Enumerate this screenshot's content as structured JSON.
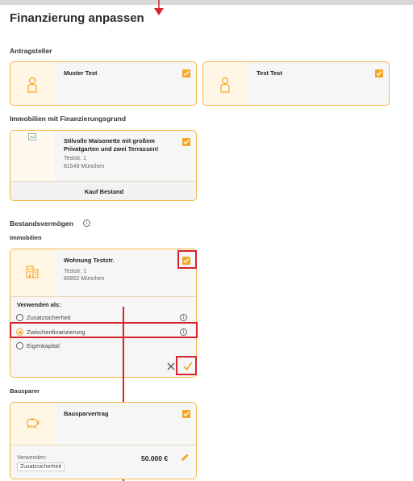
{
  "title": "Finanzierung anpassen",
  "applicants": {
    "heading": "Antragsteller",
    "items": [
      {
        "name": "Muster Test",
        "icon": "person-icon",
        "checked": true
      },
      {
        "name": "Test Test",
        "icon": "person-icon",
        "checked": true
      }
    ]
  },
  "property_reason": {
    "heading": "Immobilien mit Finanzierungsgrund",
    "item": {
      "title": "Stilvolle Maisonette mit großem Privatgarten und zwei Terrassen!",
      "street": "Teststr. 1",
      "city": "81549 München",
      "footer": "Kauf Bestand",
      "checked": true
    }
  },
  "assets": {
    "heading": "Bestandsvermögen",
    "real_estate": {
      "heading": "Immobilien",
      "item": {
        "title": "Wohnung Teststr.",
        "street": "Teststr. 1",
        "city": "80802 München",
        "checked": true,
        "use_as_label": "Verwenden als:",
        "options": [
          "Zusatzsicherheit",
          "Zwischenfinanzierung",
          "Eigenkapital"
        ],
        "selected_option": "Zwischenfinanzierung"
      }
    },
    "savings": {
      "heading": "Bausparer",
      "item": {
        "title": "Bausparvertrag",
        "checked": true,
        "use_label": "Verwenden:",
        "use_value": "Zusatzsicherheit",
        "amount": "50.000 €"
      }
    }
  },
  "colors": {
    "accent": "#f5a623",
    "highlight": "#d9242b",
    "card_border": "#f2b84b"
  }
}
